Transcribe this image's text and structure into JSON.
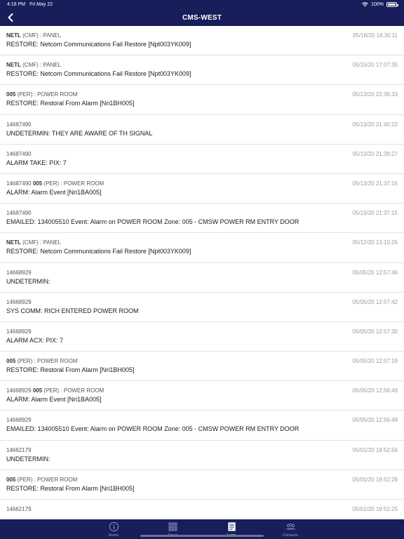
{
  "status_bar": {
    "time": "4:18 PM",
    "date": "Fri May 22",
    "battery": "100%"
  },
  "header": {
    "title": "CMS-WEST"
  },
  "entries": [
    {
      "code": "NETL",
      "info": "(CMF) : PANEL",
      "timestamp": "05/18/20 14:30:11",
      "message": "RESTORE: Netcom Communications Fail Restore [Npt003YK009]"
    },
    {
      "code": "NETL",
      "info": "(CMF) : PANEL",
      "timestamp": "05/15/20 17:07:35",
      "message": "RESTORE: Netcom Communications Fail Restore [Npt003YK009]"
    },
    {
      "code": "005",
      "info": "(PER) : POWER ROOM",
      "timestamp": "05/13/20 22:36:33",
      "message": "RESTORE: Restoral From Alarm [Nri1BH005]"
    },
    {
      "code": "",
      "info": "14687490",
      "timestamp": "05/13/20 21:40:22",
      "message": "UNDETERMIN: THEY ARE AWARE OF TH SIGNAL"
    },
    {
      "code": "",
      "info": "14687490",
      "timestamp": "05/13/20 21:39:27",
      "message": "ALARM TAKE: PIX: 7"
    },
    {
      "prefix": "14687490",
      "code": "005",
      "info": "(PER) : POWER ROOM",
      "timestamp": "05/13/20 21:37:15",
      "message": "ALARM: Alarm Event [Nri1BA005]"
    },
    {
      "code": "",
      "info": "14687490",
      "timestamp": "05/13/20 21:37:15",
      "message": "EMAILED: 134005510 Event: Alarm on POWER ROOM Zone: 005 - CMSW POWER RM ENTRY DOOR"
    },
    {
      "code": "NETL",
      "info": "(CMF) : PANEL",
      "timestamp": "05/12/20 13:10:26",
      "message": "RESTORE: Netcom Communications Fail Restore [Npt003YK009]"
    },
    {
      "code": "",
      "info": "14668929",
      "timestamp": "05/05/20 12:57:46",
      "message": "UNDETERMIN:"
    },
    {
      "code": "",
      "info": "14668929",
      "timestamp": "05/05/20 12:57:42",
      "message": "SYS COMM: RICH ENTERED POWER ROOM"
    },
    {
      "code": "",
      "info": "14668929",
      "timestamp": "05/05/20 12:57:30",
      "message": "ALARM ACX: PIX: 7"
    },
    {
      "code": "005",
      "info": "(PER) : POWER ROOM",
      "timestamp": "05/05/20 12:57:19",
      "message": "RESTORE: Restoral From Alarm [Nri1BH005]"
    },
    {
      "prefix": "14668929",
      "code": "005",
      "info": "(PER) : POWER ROOM",
      "timestamp": "05/05/20 12:56:49",
      "message": "ALARM: Alarm Event [Nri1BA005]"
    },
    {
      "code": "",
      "info": "14668929",
      "timestamp": "05/05/20 12:56:49",
      "message": "EMAILED: 134005510 Event: Alarm on POWER ROOM Zone: 005 - CMSW POWER RM ENTRY DOOR"
    },
    {
      "code": "",
      "info": "14662179",
      "timestamp": "05/01/20 19:52:56",
      "message": "UNDETERMIN:"
    },
    {
      "code": "005",
      "info": "(PER) : POWER ROOM",
      "timestamp": "05/01/20 19:52:28",
      "message": "RESTORE: Restoral From Alarm [Nri1BH005]"
    },
    {
      "code": "",
      "info": "14662179",
      "timestamp": "05/01/20 19:52:25",
      "message": ""
    }
  ],
  "tabs": [
    {
      "label": "Home",
      "icon": "info-icon",
      "active": false
    },
    {
      "label": "Zones",
      "icon": "grid-icon",
      "active": false
    },
    {
      "label": "Logs",
      "icon": "document-icon",
      "active": true
    },
    {
      "label": "Contacts",
      "icon": "contacts-icon",
      "active": false
    }
  ],
  "colors": {
    "bar": "#181e5a",
    "divider": "#e2e2e2",
    "timestamp": "#9a9a9a"
  }
}
